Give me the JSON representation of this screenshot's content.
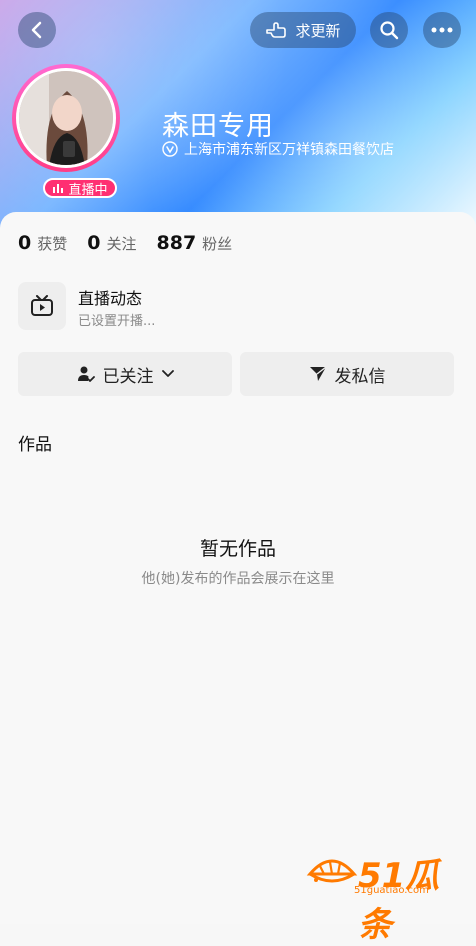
{
  "header": {
    "back_icon": "chevron-left-icon",
    "update_label": "求更新",
    "update_icon": "pointing-hand-icon",
    "search_icon": "search-icon",
    "more_icon": "more-dots-icon"
  },
  "profile": {
    "name": "森田专用",
    "location": "上海市浦东新区万祥镇森田餐饮店",
    "live_badge": "直播中"
  },
  "stats": [
    {
      "num": "0",
      "label": "获赞"
    },
    {
      "num": "0",
      "label": "关注"
    },
    {
      "num": "887",
      "label": "粉丝"
    }
  ],
  "live_status": {
    "title": "直播动态",
    "subtitle": "已设置开播..."
  },
  "actions": {
    "followed_label": "已关注",
    "message_label": "发私信"
  },
  "works": {
    "label": "作品",
    "empty_title": "暂无作品",
    "empty_subtitle": "他(她)发布的作品会展示在这里"
  },
  "watermark": {
    "main": "51瓜条",
    "url": "51guatiao.com"
  },
  "colors": {
    "live_pink": "#ff2f72",
    "accent_orange": "#ff7a00"
  }
}
